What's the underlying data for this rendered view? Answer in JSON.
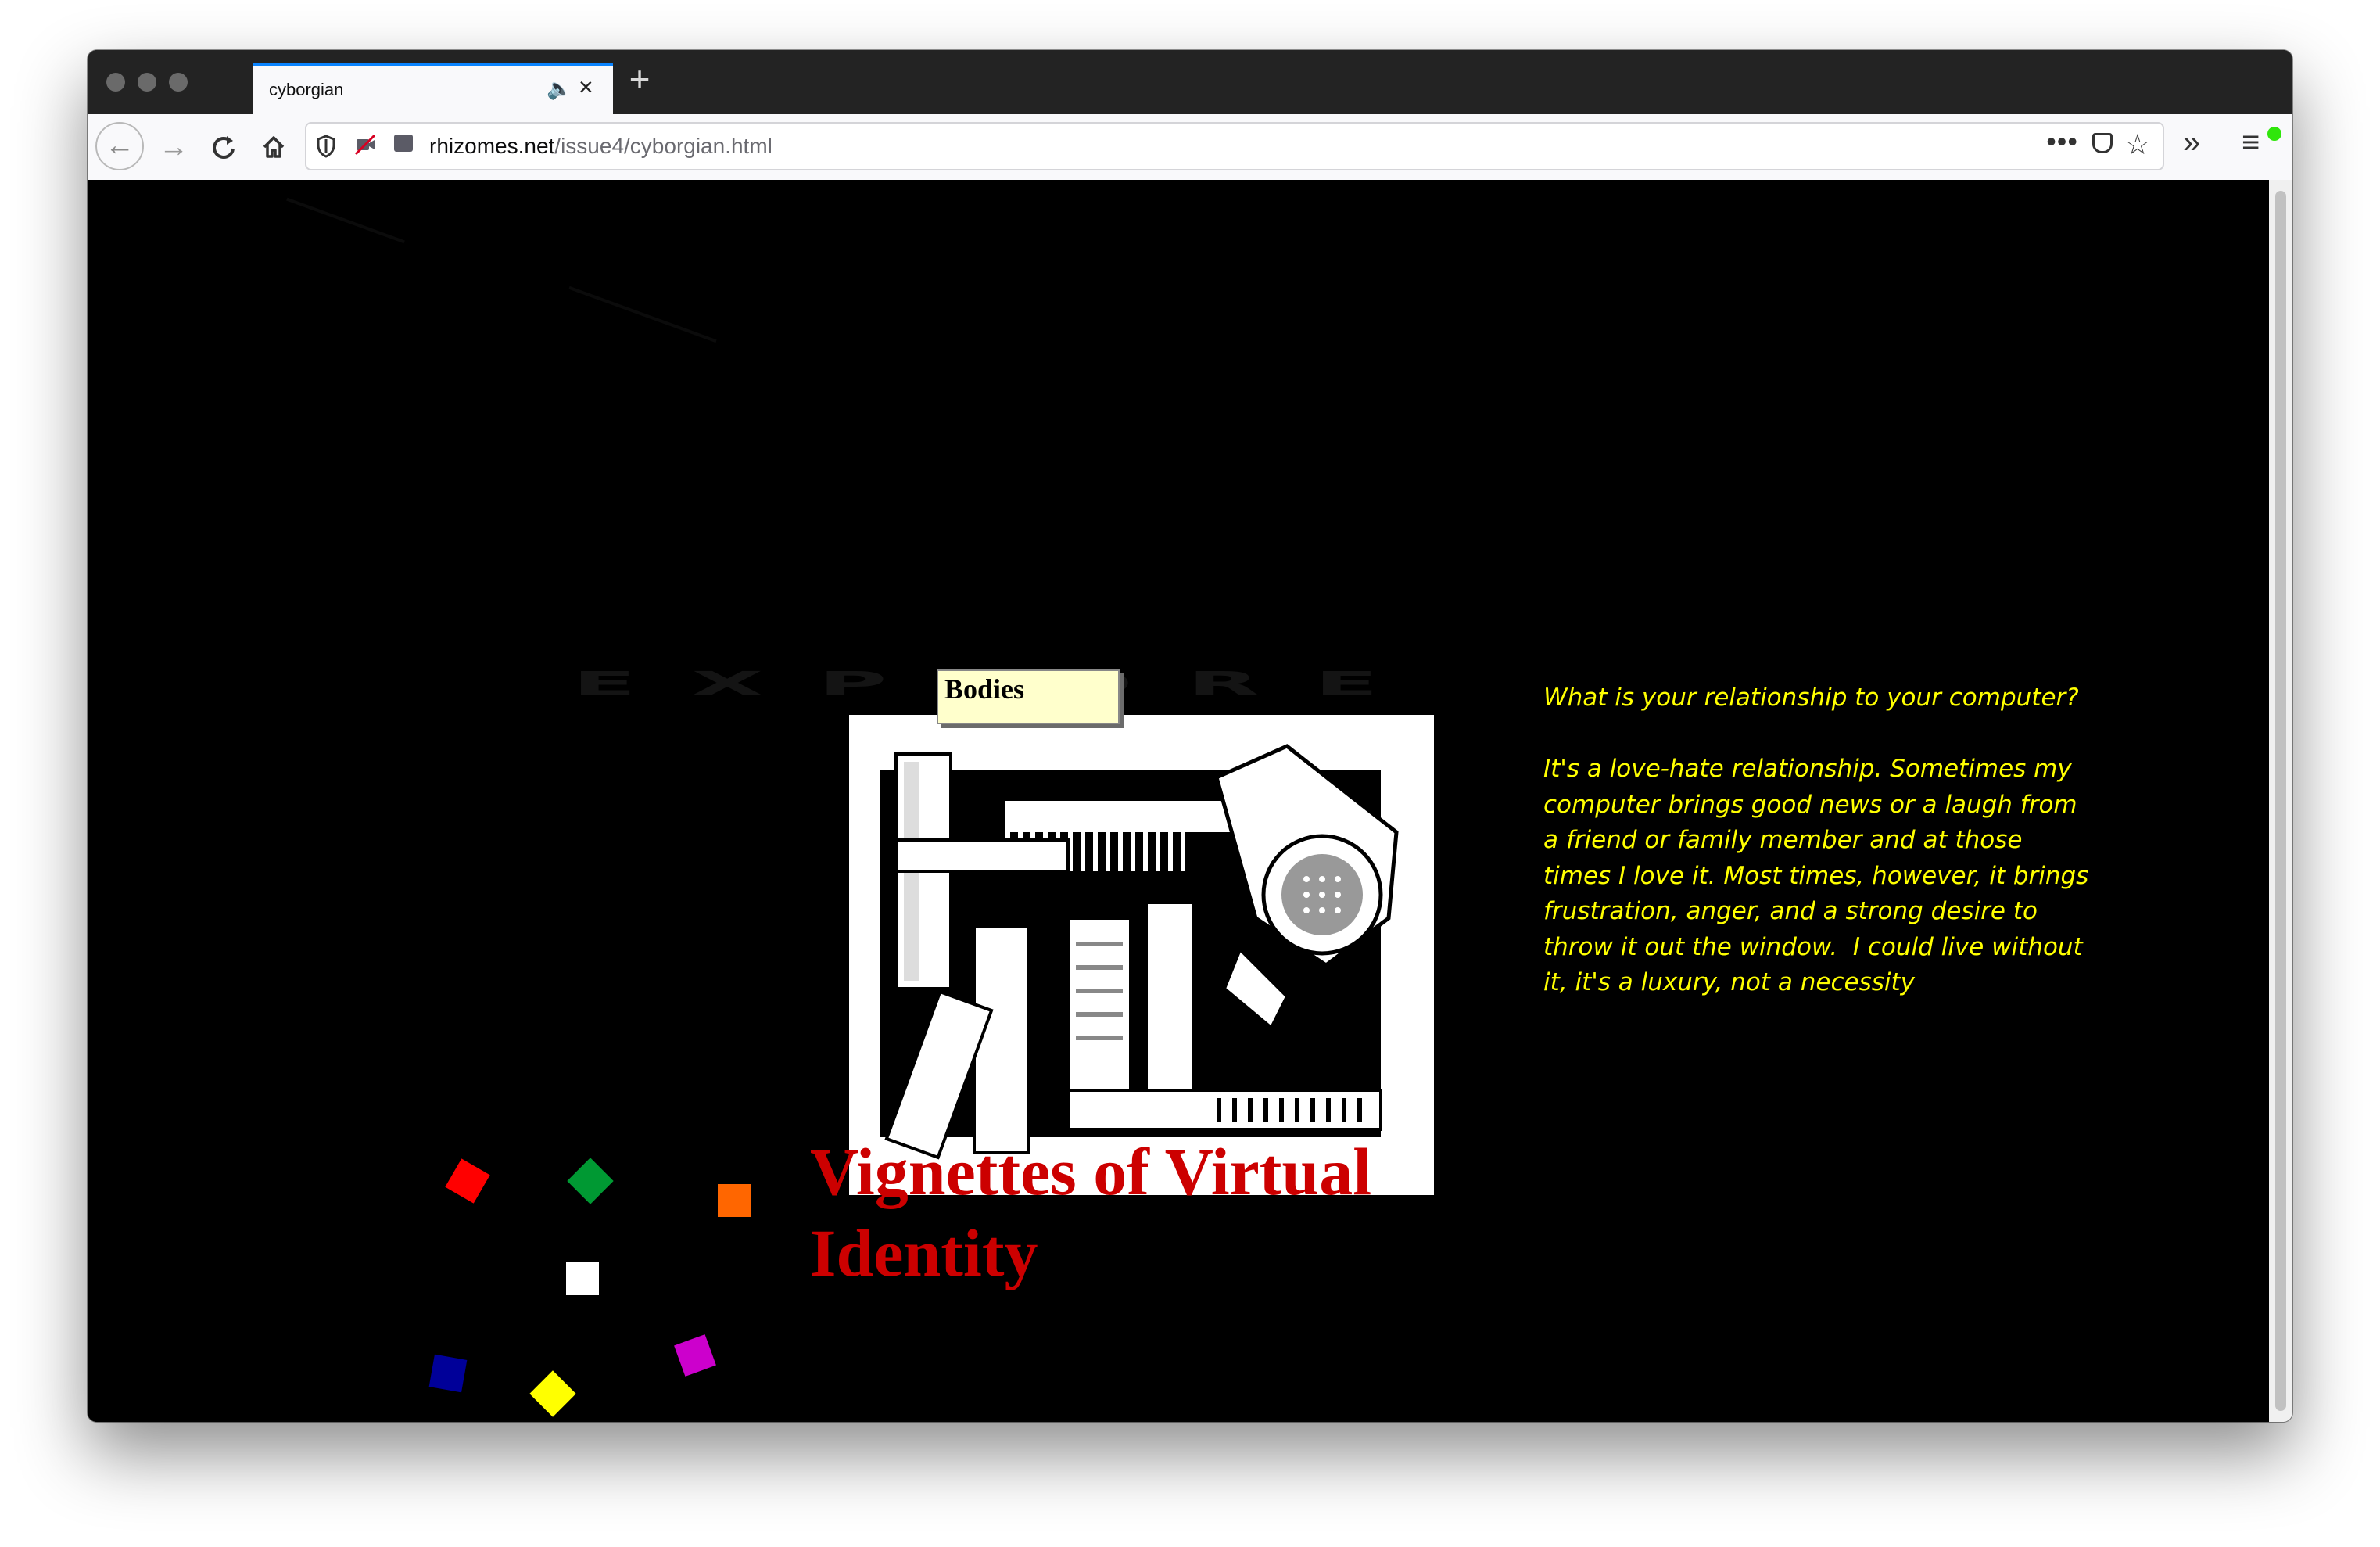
{
  "browser": {
    "tab_title": "cyborgian",
    "url_domain": "rhizomes.net",
    "url_path": "/issue4/cyborgian.html",
    "icons": [
      "back-icon",
      "forward-icon",
      "reload-icon",
      "home-icon",
      "shield-icon",
      "camera-blocked-icon",
      "folder-icon",
      "more-icon",
      "pocket-icon",
      "star-icon",
      "overflow-icon",
      "menu-icon",
      "speaker-icon",
      "close-icon",
      "plus-icon"
    ]
  },
  "page": {
    "ghost_text": "EXPLORE",
    "image_label": "Bodies",
    "headline": "Vignettes of Virtual Identity",
    "question": "What is your relationship to your computer?",
    "answer": "It's a love-hate relationship. Sometimes my computer brings good news or a laugh from a friend or family member and at those times I love it. Most times, however, it brings frustration, anger, and a strong desire to throw it out the window.  I could live without it, it's a luxury, not a necessity",
    "swatch_colors": [
      "#ff0000",
      "#009933",
      "#ff6600",
      "#ffffff",
      "#000099",
      "#cc00cc",
      "#ffff00"
    ]
  }
}
